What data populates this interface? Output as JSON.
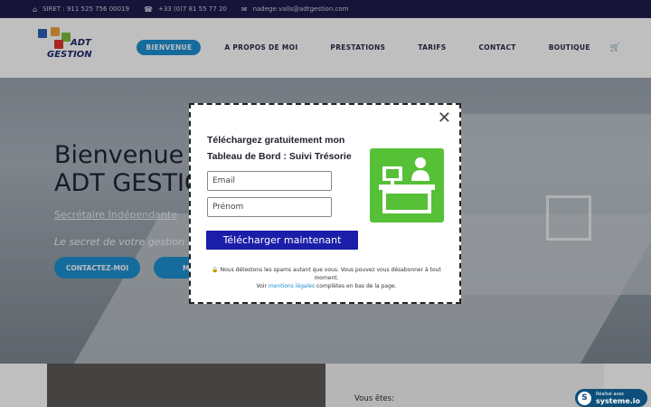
{
  "topbar": {
    "siret": "SIRET : 911 525 756 00019",
    "phone": "+33 (0)7 81 55 77 20",
    "email": "nadege.valls@adtgestion.com",
    "icons": [
      "home-icon",
      "phone-icon",
      "envelope-icon"
    ]
  },
  "logo": {
    "line1": "ADT",
    "line2": "GESTION"
  },
  "nav": {
    "items": [
      "BIENVENUE",
      "A PROPOS DE MOI",
      "PRESTATIONS",
      "TARIFS",
      "CONTACT",
      "BOUTIQUE"
    ],
    "active": "BIENVENUE",
    "cart_icon": "cart-icon"
  },
  "hero": {
    "title_line1": "Bienvenue",
    "title_line2": "ADT GESTIO",
    "subtitle": "Secrétaire Indépendante",
    "tagline": "Le secret de votre gestion fa",
    "button1": "CONTACTEZ-MOI",
    "button2": "MES P"
  },
  "lower": {
    "label": "Vous êtes:"
  },
  "popup": {
    "title": "Téléchargez gratuitement mon Tableau de Bord : Suivi Trésorie",
    "email_placeholder": "Email",
    "prenom_placeholder": "Prénom",
    "cta": "Télécharger maintenant",
    "note_line1": "🔒 Nous détestons les spams autant que vous. Vous pouvez vous désabonner à tout moment.",
    "note_line2_pre": "Voir ",
    "note_link": "mentions légales",
    "note_line2_post": " complètes en bas de la page.",
    "close_icon": "close-icon"
  },
  "badge": {
    "line1": "Réalisé avec",
    "line2": "systeme.io",
    "letter": "S"
  },
  "colors": {
    "accent": "#1d8fd0",
    "topbar": "#1e1b4b",
    "cta": "#1b1ea8",
    "illustration": "#56c036"
  }
}
